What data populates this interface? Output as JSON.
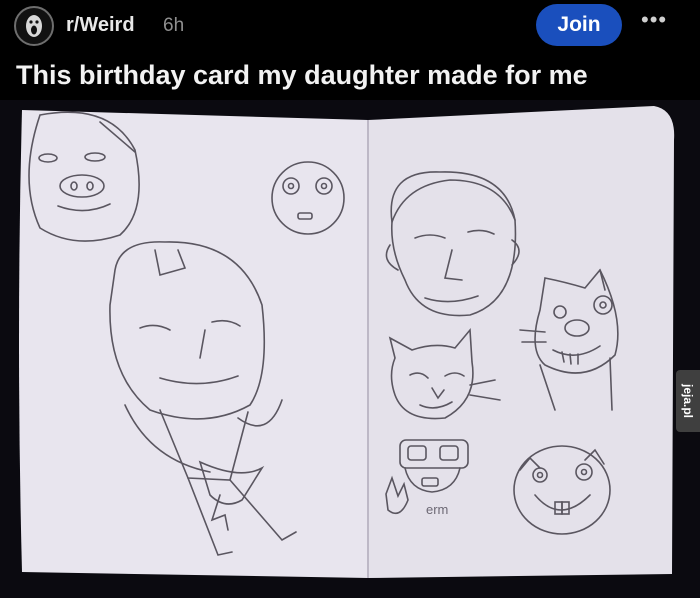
{
  "post": {
    "subreddit": "r/Weird",
    "age": "6h",
    "join_label": "Join",
    "more_label": "•••",
    "title": "This birthday card my daughter made for me"
  },
  "image": {
    "doodle_text_1": "erm",
    "watermark": "jeja.pl"
  },
  "colors": {
    "background": "#000000",
    "join_button": "#1a4fbd",
    "paper": "#e9e6ef",
    "pencil": "#5a5660"
  }
}
